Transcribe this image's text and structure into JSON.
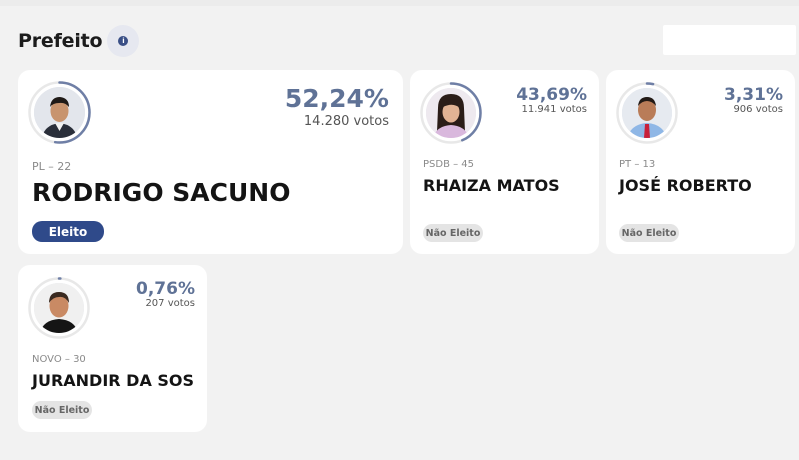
{
  "section": {
    "title": "Prefeito",
    "info_icon": "info-icon"
  },
  "candidates": [
    {
      "name": "RODRIGO SACUNO",
      "party": "PL – 22",
      "percent": "52,24%",
      "votes": "14.280 votos",
      "status": "Eleito",
      "vote_share": 0.5224
    },
    {
      "name": "RHAIZA MATOS",
      "party": "PSDB – 45",
      "percent": "43,69%",
      "votes": "11.941 votos",
      "status": "Não Eleito",
      "vote_share": 0.4369
    },
    {
      "name": "JOSÉ ROBERTO",
      "party": "PT – 13",
      "percent": "3,31%",
      "votes": "906 votos",
      "status": "Não Eleito",
      "vote_share": 0.0331
    },
    {
      "name": "JURANDIR DA SOS",
      "party": "NOVO – 30",
      "percent": "0,76%",
      "votes": "207 votos",
      "status": "Não Eleito",
      "vote_share": 0.0076
    }
  ],
  "colors": {
    "accent": "#2f4a8a",
    "percent_text": "#5f7296",
    "ring": "#6f7fa6",
    "ring_track": "#e8e8e8"
  }
}
